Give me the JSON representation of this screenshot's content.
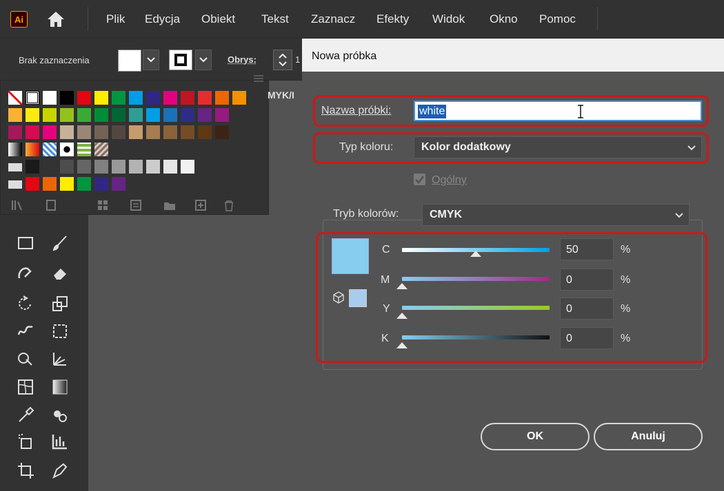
{
  "app": {
    "logo_text": "Ai"
  },
  "menu": [
    "Plik",
    "Edycja",
    "Obiekt",
    "Tekst",
    "Zaznacz",
    "Efekty",
    "Widok",
    "Okno",
    "Pomoc"
  ],
  "controlbar": {
    "selection_label": "Brak zaznaczenia",
    "stroke_label": "Obrys:",
    "stroke_value": "1"
  },
  "swatches_panel": {
    "partial_tab": "MYK/I"
  },
  "dialog": {
    "title": "Nowa próbka",
    "name_label": "Nazwa próbki:",
    "name_value": "white",
    "color_type_label": "Typ koloru:",
    "color_type_value": "Kolor dodatkowy",
    "global_label": "Ogólny",
    "global_checked": true,
    "color_mode_label": "Tryb kolorów:",
    "color_mode_value": "CMYK",
    "preview_color": "#87cdf0",
    "channels": [
      {
        "name": "C",
        "value": "50",
        "unit": "%",
        "fraction": 0.5,
        "gradient": "#ffffff,#00a0e0"
      },
      {
        "name": "M",
        "value": "0",
        "unit": "%",
        "fraction": 0.0,
        "gradient": "#87cdf0,#a02a8a"
      },
      {
        "name": "Y",
        "value": "0",
        "unit": "%",
        "fraction": 0.0,
        "gradient": "#87cdf0,#9cc820"
      },
      {
        "name": "K",
        "value": "0",
        "unit": "%",
        "fraction": 0.0,
        "gradient": "#87cdf0,#111111"
      }
    ],
    "ok_label": "OK",
    "cancel_label": "Anuluj"
  },
  "colors": {
    "highlight_red": "#cc1818",
    "selection_blue": "#1a5fb4",
    "ai_orange": "#ff9a00"
  }
}
